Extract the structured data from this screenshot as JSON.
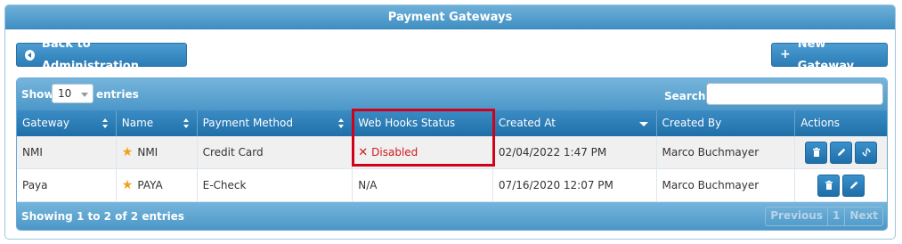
{
  "header": {
    "title": "Payment Gateways"
  },
  "toolbar": {
    "back_label": "Back to Administration",
    "new_label": "New Gateway"
  },
  "table_controls": {
    "show_label": "Show",
    "page_size": "10",
    "entries_label": "entries",
    "search_label": "Search:",
    "search_value": ""
  },
  "columns": [
    "Gateway",
    "Name",
    "Payment Method",
    "Web Hooks Status",
    "Created At",
    "Created By",
    "Actions"
  ],
  "rows": [
    {
      "gateway": "NMI",
      "name": "NMI",
      "method": "Credit Card",
      "webhooks": "Disabled",
      "created_at": "02/04/2022 1:47 PM",
      "created_by": "Marco Buchmayer"
    },
    {
      "gateway": "Paya",
      "name": "PAYA",
      "method": "E-Check",
      "webhooks": "N/A",
      "created_at": "07/16/2020 12:07 PM",
      "created_by": "Marco Buchmayer"
    }
  ],
  "footer": {
    "info": "Showing 1 to 2 of 2 entries",
    "previous": "Previous",
    "page": "1",
    "next": "Next"
  },
  "colors": {
    "header_blue": "#3f8fc3",
    "button_blue": "#2c7cb6",
    "disabled_red": "#d01b1b",
    "highlight_red": "#d0021b",
    "star": "#f0a11c"
  }
}
